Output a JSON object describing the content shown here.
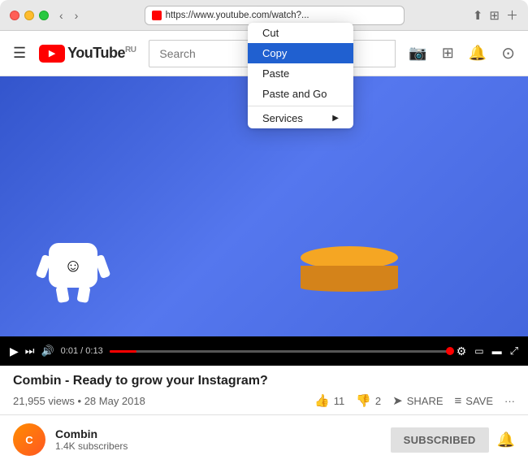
{
  "window": {
    "address": "https://www.youtube.com/watch?...",
    "nav_back": "‹",
    "nav_forward": "›"
  },
  "context_menu": {
    "items": [
      {
        "id": "cut",
        "label": "Cut",
        "selected": false
      },
      {
        "id": "copy",
        "label": "Copy",
        "selected": true
      },
      {
        "id": "paste",
        "label": "Paste",
        "selected": false
      },
      {
        "id": "paste_go",
        "label": "Paste and Go",
        "selected": false
      },
      {
        "id": "services",
        "label": "Services",
        "has_submenu": true,
        "selected": false
      }
    ]
  },
  "youtube": {
    "search_placeholder": "Search",
    "logo_text": "YouTube",
    "logo_suffix": "RU",
    "video": {
      "title": "Combin - Ready to grow your Instagram?",
      "views": "21,955 views",
      "date": "28 May 2018",
      "time_current": "0:01",
      "time_total": "0:13",
      "likes": "11",
      "dislikes": "2",
      "share_label": "SHARE",
      "save_label": "SAVE"
    },
    "channel": {
      "name": "Combin",
      "subscribers": "1.4K subscribers",
      "avatar_letter": "C",
      "subscribe_label": "SUBSCRIBED"
    }
  },
  "icons": {
    "hamburger": "☰",
    "camera": "📷",
    "grid": "⊞",
    "bell": "🔔",
    "user": "○",
    "play": "▶",
    "next": "⏭",
    "volume": "🔊",
    "settings": "⚙",
    "miniplayer": "▭",
    "theater": "▬",
    "fullscreen": "⤢",
    "like": "👍",
    "dislike": "👎",
    "share_icon": "➤",
    "save_icon": "≡",
    "more": "···",
    "bell_channel": "🔔",
    "chevron_right": "▶"
  }
}
